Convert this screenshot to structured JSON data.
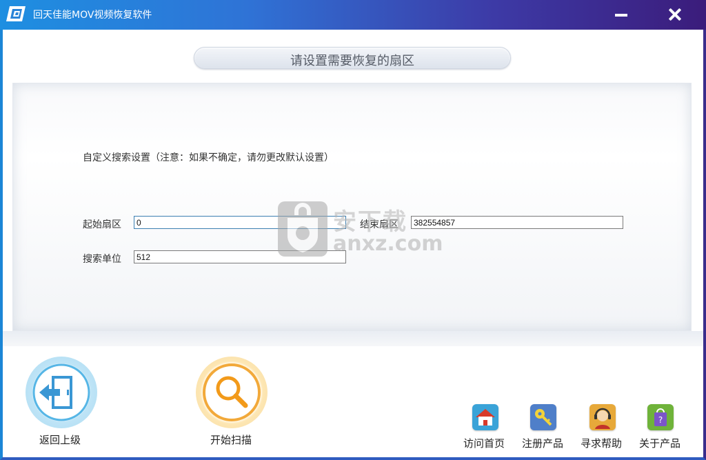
{
  "window": {
    "title": "回天佳能MOV视频恢复软件",
    "titlebar_colors": [
      "#1e8fe1",
      "#3b1c7b"
    ]
  },
  "controls": {
    "minimize_icon": "minimize-icon",
    "close_icon": "close-icon"
  },
  "main": {
    "heading": "请设置需要恢复的扇区",
    "note": "自定义搜索设置（注意：如果不确定，请勿更改默认设置）",
    "fields": {
      "start_sector": {
        "label": "起始扇区",
        "value": "0"
      },
      "end_sector": {
        "label": "结束扇区",
        "value": "382554857"
      },
      "search_unit": {
        "label": "搜索单位",
        "value": "512"
      }
    }
  },
  "watermark": {
    "text": "安下载",
    "url": "anxz.com"
  },
  "footer": {
    "back_label": "返回上级",
    "scan_label": "开始扫描",
    "links": [
      {
        "label": "访问首页",
        "icon": "home-icon",
        "color": "#3aa3d8"
      },
      {
        "label": "注册产品",
        "icon": "key-icon",
        "color": "#4f7fc9"
      },
      {
        "label": "寻求帮助",
        "icon": "support-agent-icon",
        "color": "#e7a93a"
      },
      {
        "label": "关于产品",
        "icon": "shopping-bag-icon",
        "color": "#6fb33a"
      }
    ]
  }
}
